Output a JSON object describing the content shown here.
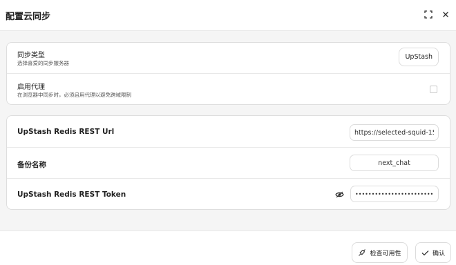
{
  "modal": {
    "title": "配置云同步"
  },
  "sync_type": {
    "title": "同步类型",
    "subtitle": "选择喜爱的同步服务器",
    "value": "UpStash"
  },
  "proxy": {
    "title": "启用代理",
    "subtitle": "在浏览器中同步时，必须启用代理以避免跨域限制",
    "enabled": false
  },
  "upstash": {
    "url_label": "UpStash Redis REST Url",
    "url_value": "https://selected-squid-15",
    "backup_label": "备份名称",
    "backup_value": "next_chat",
    "token_label": "UpStash Redis REST Token",
    "token_value": "••••••••••••••••••••••••••••••"
  },
  "footer": {
    "check_label": "检查可用性",
    "confirm_label": "确认"
  },
  "icons": {
    "maximize": "maximize-icon",
    "close": "close-icon",
    "eye": "eye-icon",
    "connection": "connection-icon",
    "check": "check-icon"
  }
}
